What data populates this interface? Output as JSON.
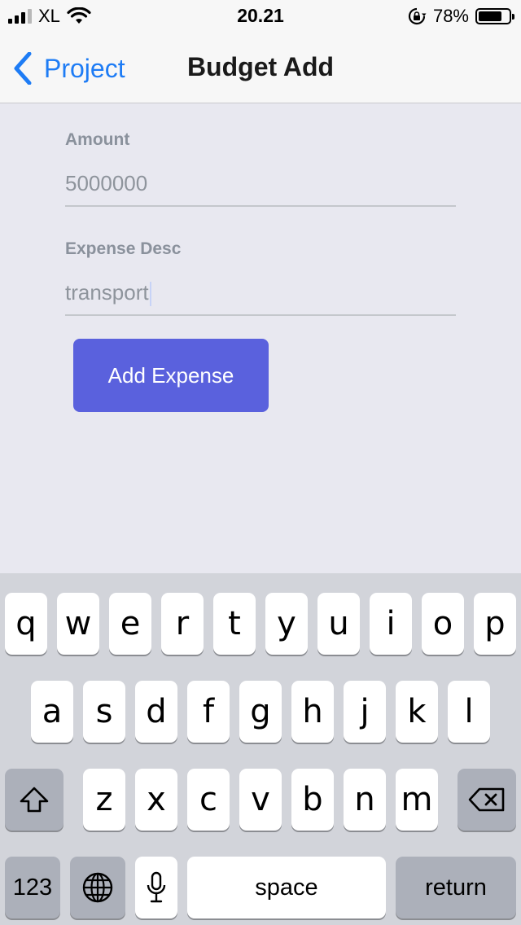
{
  "status_bar": {
    "carrier": "XL",
    "time": "20.21",
    "battery_text": "78%",
    "battery_level": 0.78,
    "icons": [
      "signal-icon",
      "wifi-icon",
      "rotation-lock-icon",
      "battery-icon"
    ]
  },
  "nav": {
    "back_label": "Project",
    "title": "Budget Add",
    "accent_color": "#1e7cf5"
  },
  "form": {
    "amount_label": "Amount",
    "amount_value": "5000000",
    "desc_label": "Expense Desc",
    "desc_value": "transport",
    "submit_label": "Add Expense",
    "button_color": "#5a61dd"
  },
  "keyboard": {
    "row1": [
      "q",
      "w",
      "e",
      "r",
      "t",
      "y",
      "u",
      "i",
      "o",
      "p"
    ],
    "row2": [
      "a",
      "s",
      "d",
      "f",
      "g",
      "h",
      "j",
      "k",
      "l"
    ],
    "row3": [
      "z",
      "x",
      "c",
      "v",
      "b",
      "n",
      "m"
    ],
    "numbers_label": "123",
    "space_label": "space",
    "return_label": "return",
    "icons": [
      "shift-icon",
      "backspace-icon",
      "globe-icon",
      "microphone-icon"
    ]
  }
}
